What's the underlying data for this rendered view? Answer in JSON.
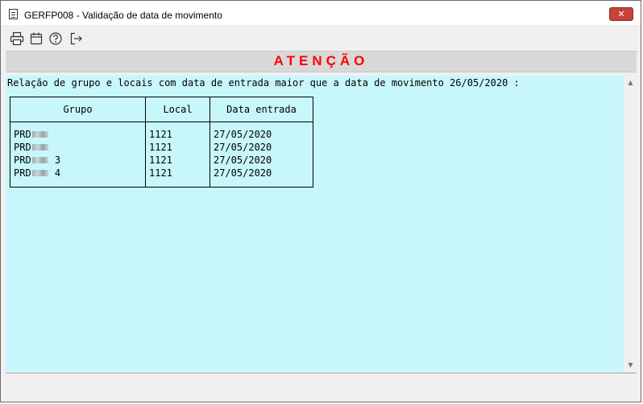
{
  "window": {
    "title": "GERFP008 - Validação de data de movimento",
    "close_label": "✕"
  },
  "toolbar": {
    "buttons": [
      {
        "icon": "printer-icon"
      },
      {
        "icon": "calendar-icon"
      },
      {
        "icon": "help-icon"
      },
      {
        "icon": "exit-icon"
      }
    ]
  },
  "banner": {
    "text": "ATENÇÃO",
    "color": "#ff0000"
  },
  "report": {
    "intro": "Relação de grupo e locais com data de entrada maior que a data de movimento 26/05/2020 :",
    "columns": [
      "Grupo",
      "Local",
      "Data entrada"
    ],
    "rows": [
      {
        "grupo_prefix": "PRD",
        "grupo_suffix": "",
        "local": "1121",
        "data": "27/05/2020"
      },
      {
        "grupo_prefix": "PRD",
        "grupo_suffix": "",
        "local": "1121",
        "data": "27/05/2020"
      },
      {
        "grupo_prefix": "PRD",
        "grupo_suffix": " 3",
        "local": "1121",
        "data": "27/05/2020"
      },
      {
        "grupo_prefix": "PRD",
        "grupo_suffix": " 4",
        "local": "1121",
        "data": "27/05/2020"
      }
    ]
  },
  "colors": {
    "content_bg": "#c8f7fb",
    "close_bg": "#c9413a"
  }
}
